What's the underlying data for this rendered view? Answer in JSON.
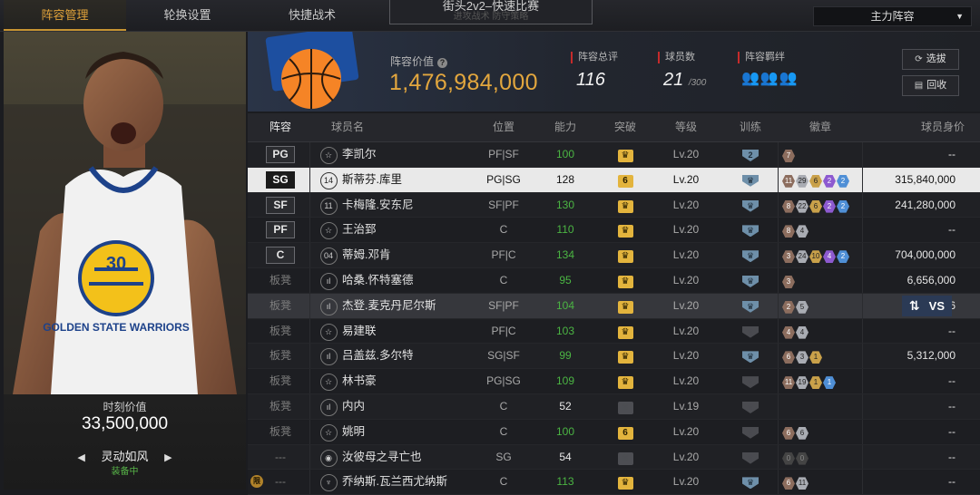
{
  "tabs": [
    {
      "label": "阵容管理",
      "active": true
    },
    {
      "label": "轮换设置",
      "active": false
    },
    {
      "label": "快捷战术",
      "active": false
    }
  ],
  "mode": {
    "title": "街头2v2–快速比赛",
    "ghost": "进攻战术      防守策略"
  },
  "lineup_select": {
    "value": "主力阵容"
  },
  "featured": {
    "value_label": "时刻价值",
    "value": "33,500,000",
    "jersey_team": "GOLDEN STATE WARRIORS",
    "jersey_number": "30",
    "skill": "灵动如风",
    "skill_status": "装备中"
  },
  "team": {
    "value_label": "阵容价值",
    "value": "1,476,984,000",
    "rating_label": "阵容总评",
    "rating": "116",
    "count_label": "球员数",
    "count": "21",
    "count_max": "/300",
    "bond_label": "阵容羁绊",
    "scout_btn": "选拔",
    "recycle_btn": "回收"
  },
  "columns": {
    "role": "阵容",
    "name": "球员名",
    "pos": "位置",
    "ability": "能力",
    "breakthrough": "突破",
    "level": "等级",
    "training": "训练",
    "badges": "徽章",
    "price": "球员身价"
  },
  "colors": {
    "accent": "#e3a73e",
    "green": "#4bb543",
    "selected_row": "#e9e9e9"
  },
  "rows": [
    {
      "role": "PG",
      "starter": true,
      "icon": "star-icon",
      "glyph": "☆",
      "name": "李凯尔",
      "pos": "PF|SF",
      "ability": "100",
      "ability_color": "green",
      "brk": "",
      "brk_active": true,
      "lv": "Lv.20",
      "train": "2",
      "train_active": true,
      "badges": [
        {
          "t": "7",
          "c": "br"
        }
      ],
      "price": "--"
    },
    {
      "role": "SG",
      "starter": true,
      "icon": "number-14-icon",
      "glyph": "14",
      "name": "斯蒂芬.库里",
      "pos": "PG|SG",
      "ability": "128",
      "ability_color": "white",
      "brk": "6",
      "brk_active": true,
      "lv": "Lv.20",
      "train": "",
      "train_active": true,
      "badges": [
        {
          "t": "11",
          "c": "br"
        },
        {
          "t": "29",
          "c": "sv"
        },
        {
          "t": "6",
          "c": "gd"
        },
        {
          "t": "2",
          "c": "pu"
        },
        {
          "t": "2",
          "c": "bl"
        }
      ],
      "price": "315,840,000",
      "selected": true
    },
    {
      "role": "SF",
      "starter": true,
      "icon": "number-11-icon",
      "glyph": "11",
      "name": "卡梅隆.安东尼",
      "pos": "SF|PF",
      "ability": "130",
      "ability_color": "green",
      "brk": "",
      "brk_active": true,
      "lv": "Lv.20",
      "train": "",
      "train_active": true,
      "badges": [
        {
          "t": "8",
          "c": "br"
        },
        {
          "t": "22",
          "c": "sv"
        },
        {
          "t": "6",
          "c": "gd"
        },
        {
          "t": "2",
          "c": "pu"
        },
        {
          "t": "2",
          "c": "bl"
        }
      ],
      "price": "241,280,000"
    },
    {
      "role": "PF",
      "starter": true,
      "icon": "star-icon",
      "glyph": "☆",
      "name": "王治郅",
      "pos": "C",
      "ability": "110",
      "ability_color": "green",
      "brk": "",
      "brk_active": true,
      "lv": "Lv.20",
      "train": "",
      "train_active": true,
      "badges": [
        {
          "t": "8",
          "c": "br"
        },
        {
          "t": "4",
          "c": "sv"
        }
      ],
      "price": "--"
    },
    {
      "role": "C",
      "starter": true,
      "icon": "number-04-icon",
      "glyph": "04",
      "name": "蒂姆.邓肯",
      "pos": "PF|C",
      "ability": "134",
      "ability_color": "green",
      "brk": "",
      "brk_active": true,
      "lv": "Lv.20",
      "train": "",
      "train_active": true,
      "badges": [
        {
          "t": "3",
          "c": "br"
        },
        {
          "t": "24",
          "c": "sv"
        },
        {
          "t": "10",
          "c": "gd"
        },
        {
          "t": "4",
          "c": "pu"
        },
        {
          "t": "2",
          "c": "bl"
        }
      ],
      "price": "704,000,000"
    },
    {
      "role": "板凳",
      "starter": false,
      "icon": "bars-icon",
      "glyph": "ıl",
      "name": "哈桑.怀特塞德",
      "pos": "C",
      "ability": "95",
      "ability_color": "green",
      "brk": "",
      "brk_active": true,
      "lv": "Lv.20",
      "train": "",
      "train_active": true,
      "badges": [
        {
          "t": "3",
          "c": "br"
        }
      ],
      "price": "6,656,000"
    },
    {
      "role": "板凳",
      "starter": false,
      "icon": "bars-icon",
      "glyph": "ıl",
      "name": "杰登.麦克丹尼尔斯",
      "pos": "SF|PF",
      "ability": "104",
      "ability_color": "green",
      "brk": "",
      "brk_active": true,
      "lv": "Lv.20",
      "train": "",
      "train_active": true,
      "badges": [
        {
          "t": "2",
          "c": "br"
        },
        {
          "t": "5",
          "c": "sv"
        }
      ],
      "price": "6",
      "highlight": true,
      "swap_label": "⇅",
      "vs_label": "VS"
    },
    {
      "role": "板凳",
      "starter": false,
      "icon": "star-icon",
      "glyph": "☆",
      "name": "易建联",
      "pos": "PF|C",
      "ability": "103",
      "ability_color": "green",
      "brk": "",
      "brk_active": true,
      "lv": "Lv.20",
      "train": "",
      "train_active": false,
      "badges": [
        {
          "t": "4",
          "c": "br"
        },
        {
          "t": "4",
          "c": "sv"
        }
      ],
      "price": "--"
    },
    {
      "role": "板凳",
      "starter": false,
      "icon": "bars-icon",
      "glyph": "ıl",
      "name": "吕盖兹.多尔特",
      "pos": "SG|SF",
      "ability": "99",
      "ability_color": "green",
      "brk": "",
      "brk_active": true,
      "lv": "Lv.20",
      "train": "",
      "train_active": true,
      "badges": [
        {
          "t": "6",
          "c": "br"
        },
        {
          "t": "3",
          "c": "sv"
        },
        {
          "t": "1",
          "c": "gd"
        }
      ],
      "price": "5,312,000"
    },
    {
      "role": "板凳",
      "starter": false,
      "icon": "star-icon",
      "glyph": "☆",
      "name": "林书豪",
      "pos": "PG|SG",
      "ability": "109",
      "ability_color": "green",
      "brk": "",
      "brk_active": true,
      "lv": "Lv.20",
      "train": "",
      "train_active": false,
      "badges": [
        {
          "t": "11",
          "c": "br"
        },
        {
          "t": "19",
          "c": "sv"
        },
        {
          "t": "1",
          "c": "gd"
        },
        {
          "t": "1",
          "c": "bl"
        }
      ],
      "price": "--"
    },
    {
      "role": "板凳",
      "starter": false,
      "icon": "bars-icon",
      "glyph": "ıl",
      "name": "内内",
      "pos": "C",
      "ability": "52",
      "ability_color": "white",
      "brk": "",
      "brk_active": false,
      "lv": "Lv.19",
      "train": "",
      "train_active": false,
      "badges": [],
      "price": "--"
    },
    {
      "role": "板凳",
      "starter": false,
      "icon": "star-icon",
      "glyph": "☆",
      "name": "姚明",
      "pos": "C",
      "ability": "100",
      "ability_color": "green",
      "brk": "6",
      "brk_active": true,
      "lv": "Lv.20",
      "train": "",
      "train_active": false,
      "badges": [
        {
          "t": "6",
          "c": "br"
        },
        {
          "t": "6",
          "c": "sv"
        }
      ],
      "price": "--"
    },
    {
      "role": "---",
      "starter": false,
      "icon": "person-icon",
      "glyph": "◉",
      "name": "汝彼母之寻亡也",
      "pos": "SG",
      "ability": "54",
      "ability_color": "white",
      "brk": "",
      "brk_active": false,
      "lv": "Lv.20",
      "train": "",
      "train_active": false,
      "badges": [
        {
          "t": "0",
          "c": "dk"
        },
        {
          "t": "0",
          "c": "dk"
        }
      ],
      "price": "--"
    },
    {
      "role": "---",
      "starter": false,
      "icon": "trophy-icon",
      "glyph": "♆",
      "name": "乔纳斯.瓦兰西尤纳斯",
      "pos": "C",
      "ability": "113",
      "ability_color": "green",
      "brk": "",
      "brk_active": true,
      "lv": "Lv.20",
      "train": "",
      "train_active": true,
      "badges": [
        {
          "t": "6",
          "c": "br"
        },
        {
          "t": "11",
          "c": "sv"
        }
      ],
      "price": "--",
      "limited": "限"
    }
  ]
}
